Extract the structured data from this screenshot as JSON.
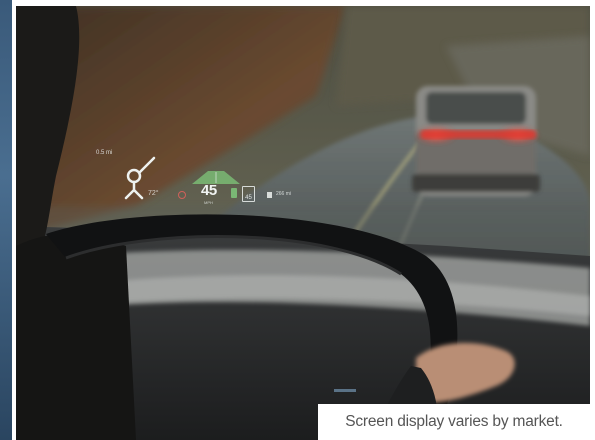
{
  "hud": {
    "nav_distance": "0.5 mi",
    "temperature": "72°",
    "speed": "45",
    "speed_unit": "MPH",
    "speed_limit": "45",
    "range": "266 mi"
  },
  "caption": {
    "text": "Screen display varies by market."
  },
  "colors": {
    "taillight": "#e0382e",
    "hud_green": "#7fc77a",
    "hud_text": "#eef2f0",
    "caption_text": "#555555"
  }
}
